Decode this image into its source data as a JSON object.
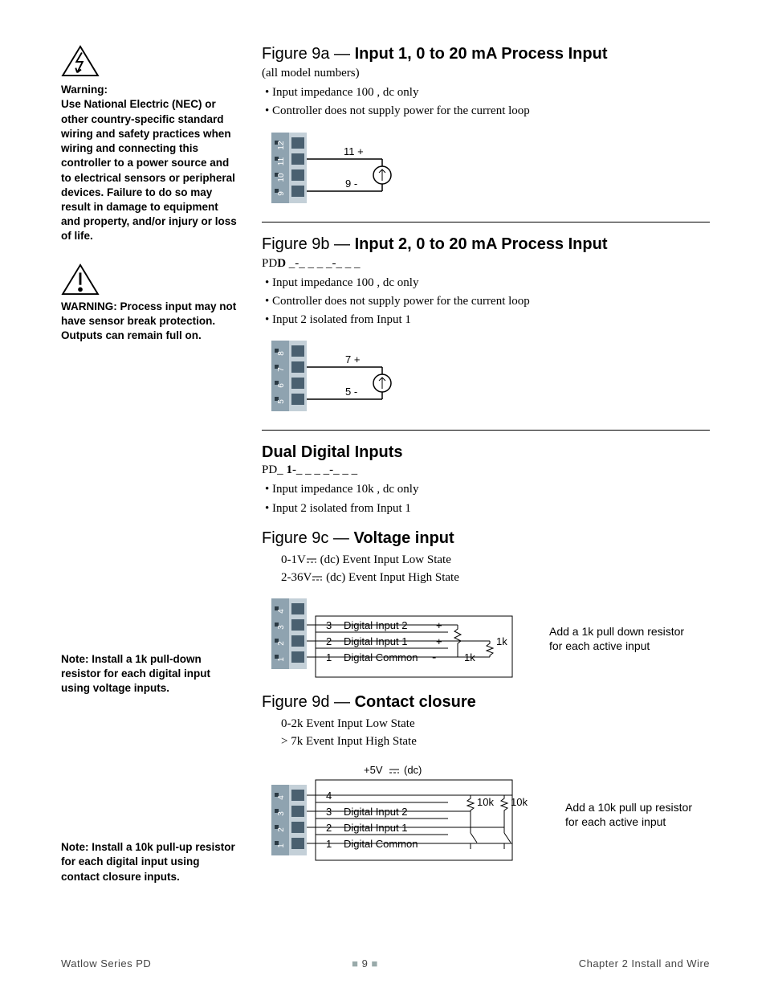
{
  "sidebar": {
    "warn1_heading": "Warning:",
    "warn1_body": "Use National Electric (NEC) or other country-specific standard wiring and safety practices when wiring and connecting this controller to a power source and to electrical sensors or peripheral devices. Failure to do so may result in damage to equipment and property, and/or injury or loss of life.",
    "warn2_body": "WARNING: Process input may not have sensor break protection. Outputs can remain full on.",
    "note1": "Note: Install a 1k  pull-down resistor for each digital input using voltage inputs.",
    "note2": "Note: Install a 10k  pull-up resistor for each digital input using contact closure inputs."
  },
  "fig9a": {
    "label": "Figure 9a — ",
    "title": "Input 1, 0 to 20 mA Process Input",
    "sub": "(all model numbers)",
    "bullets": [
      "Input impedance 100  , dc only",
      "Controller does not supply power for the current loop"
    ],
    "t11": "11",
    "t9": "9",
    "pins": [
      "9",
      "10",
      "11",
      "12"
    ]
  },
  "fig9b": {
    "label": "Figure 9b — ",
    "title": "Input 2, 0 to 20 mA Process Input",
    "model_pre": "PD",
    "model_bold": "D",
    "model_rest": " _-_ _ _ _-_ _ _",
    "bullets": [
      "Input impedance 100  , dc only",
      "Controller does not supply power for the current loop",
      "Input 2 isolated from Input 1"
    ],
    "t7": "7",
    "t5": "5",
    "pins": [
      "5",
      "6",
      "7",
      "8"
    ]
  },
  "dual": {
    "title": "Dual Digital Inputs",
    "model_pre": "PD_ ",
    "model_bold": "1",
    "model_rest": "-_ _ _ _-_ _ _",
    "bullets": [
      "Input impedance 10k  , dc only",
      "Input 2 isolated from Input 1"
    ]
  },
  "fig9c": {
    "label": "Figure 9c — ",
    "title": "Voltage input",
    "state_low": "0-1V   (dc) Event Input Low State",
    "state_high": "2-36V   (dc) Event Input High State",
    "rows": {
      "r3": "Digital Input 2",
      "r2": "Digital Input 1",
      "r1": "Digital Common"
    },
    "pins": [
      "1",
      "2",
      "3",
      "4"
    ],
    "r3n": "3",
    "r2n": "2",
    "r1n": "1",
    "res": "1k",
    "plus": "+",
    "minus": "-",
    "callout": "Add a 1k  pull down resistor for each active input"
  },
  "fig9d": {
    "label": "Figure 9d — ",
    "title": "Contact closure",
    "state_low": "0-2k  Event Input Low State",
    "state_high": "> 7k  Event Input High State",
    "vlabel": "+5V   (dc)",
    "rows": {
      "r4": "",
      "r3": "Digital Input 2",
      "r2": "Digital Input 1",
      "r1": "Digital Common"
    },
    "pins": [
      "1",
      "2",
      "3",
      "4"
    ],
    "r4n": "4",
    "r3n": "3",
    "r2n": "2",
    "r1n": "1",
    "res": "10k",
    "callout": "Add a 10k  pull up resistor for each active input"
  },
  "footer": {
    "left": "Watlow Series PD",
    "page": "9",
    "right": "Chapter 2 Install and Wire"
  }
}
